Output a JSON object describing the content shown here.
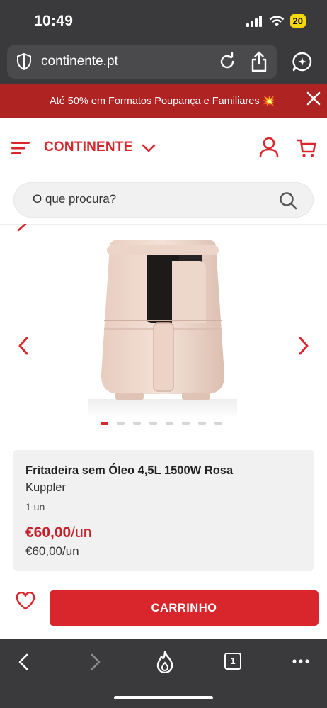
{
  "status": {
    "time": "10:49",
    "battery": "20"
  },
  "browser": {
    "url": "continente.pt"
  },
  "promo": {
    "text": "Até 50% em Formatos Poupança e Familiares 💥"
  },
  "header": {
    "logo": "CONTINENTE"
  },
  "search": {
    "placeholder": "O que procura?"
  },
  "carousel": {
    "slide_count": 8,
    "active_index": 0
  },
  "product": {
    "title": "Fritadeira sem Óleo 4,5L 1500W Rosa",
    "brand": "Kuppler",
    "unit": "1 un",
    "price": "€60,00",
    "price_suffix": "/un",
    "price_ref": "€60,00/un"
  },
  "actions": {
    "cart_label": "CARRINHO"
  },
  "bottom_bar": {
    "tab_count": "1"
  },
  "colors": {
    "brand_red": "#d9262c",
    "promo_bg": "#b02323",
    "chrome_bg": "#3a3a3c"
  }
}
